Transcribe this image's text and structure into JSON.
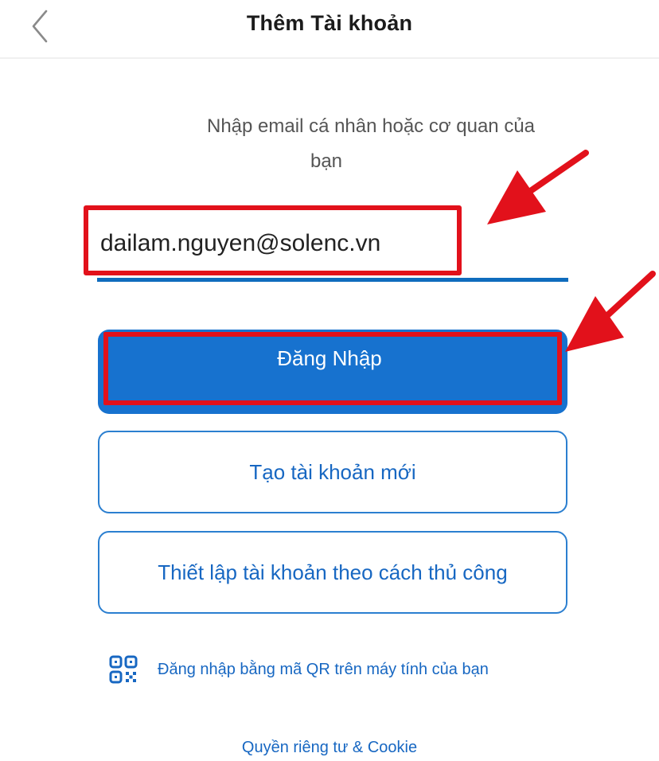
{
  "header": {
    "title": "Thêm Tài khoản",
    "back_icon": "chevron-left-icon"
  },
  "prompt": {
    "line1": "Nhập email cá nhân hoặc cơ quan của",
    "line2": "bạn"
  },
  "email": {
    "value": "dailam.nguyen@solenc.vn"
  },
  "buttons": {
    "login_label": "Đăng Nhập",
    "create_label": "Tạo tài khoản mới",
    "manual_label": "Thiết lập tài khoản theo cách thủ công"
  },
  "qr": {
    "icon": "qr-code-icon",
    "label": "Đăng nhập bằng mã QR trên máy tính của bạn"
  },
  "footer": {
    "privacy_label": "Quyền riêng tư & Cookie"
  },
  "colors": {
    "accent": "#1772cf",
    "link": "#1767c2",
    "annotation_red": "#e2111b"
  }
}
